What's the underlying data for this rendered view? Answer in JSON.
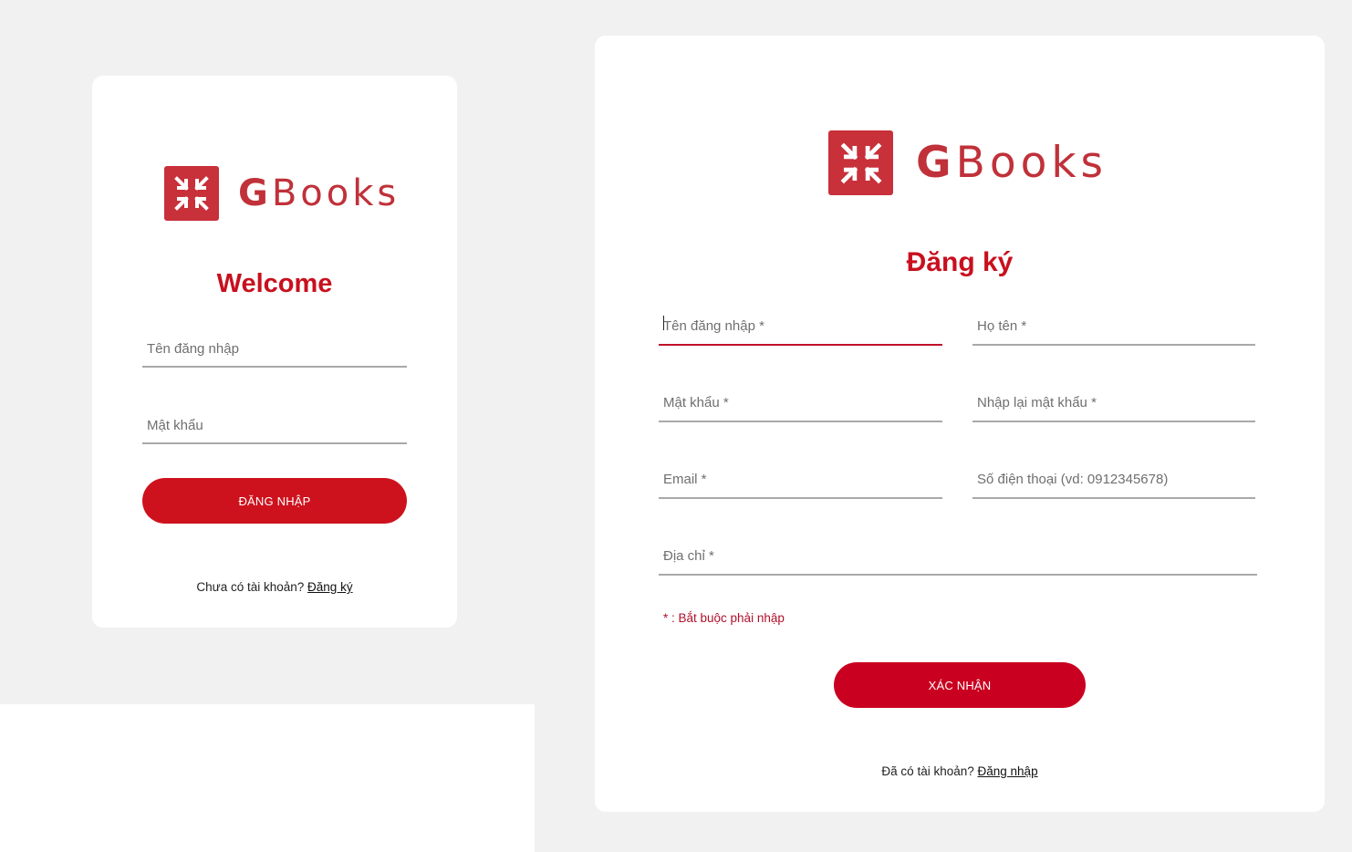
{
  "colors": {
    "background": "#f1f1f1",
    "card": "#ffffff",
    "primary_red": "#c8101e",
    "logo_red": "#c8303a",
    "register_button_red": "#c90020"
  },
  "login": {
    "logo": {
      "icon": "gbooks-logo-icon",
      "brand_g": "G",
      "brand_rest": "Books"
    },
    "title": "Welcome",
    "username_placeholder": "Tên đăng nhập",
    "password_placeholder": "Mật khẩu",
    "submit_label": "ĐĂNG NHẬP",
    "footer_text": "Chưa có tài khoản?",
    "footer_link": "Đăng ký"
  },
  "register": {
    "logo": {
      "icon": "gbooks-logo-icon",
      "brand_g": "G",
      "brand_rest": "Books"
    },
    "title": "Đăng ký",
    "fields": {
      "username": "Tên đăng nhập *",
      "fullname": "Họ tên *",
      "password": "Mật khẩu *",
      "confirm_password": "Nhập lại mật khẩu *",
      "email": "Email *",
      "phone": "Số điện thoại (vd: 0912345678)",
      "address": "Địa chỉ *"
    },
    "required_note": "* : Bắt buộc phải nhập",
    "submit_label": "XÁC NHẬN",
    "footer_text": "Đã có tài khoản?",
    "footer_link": "Đăng nhập"
  }
}
